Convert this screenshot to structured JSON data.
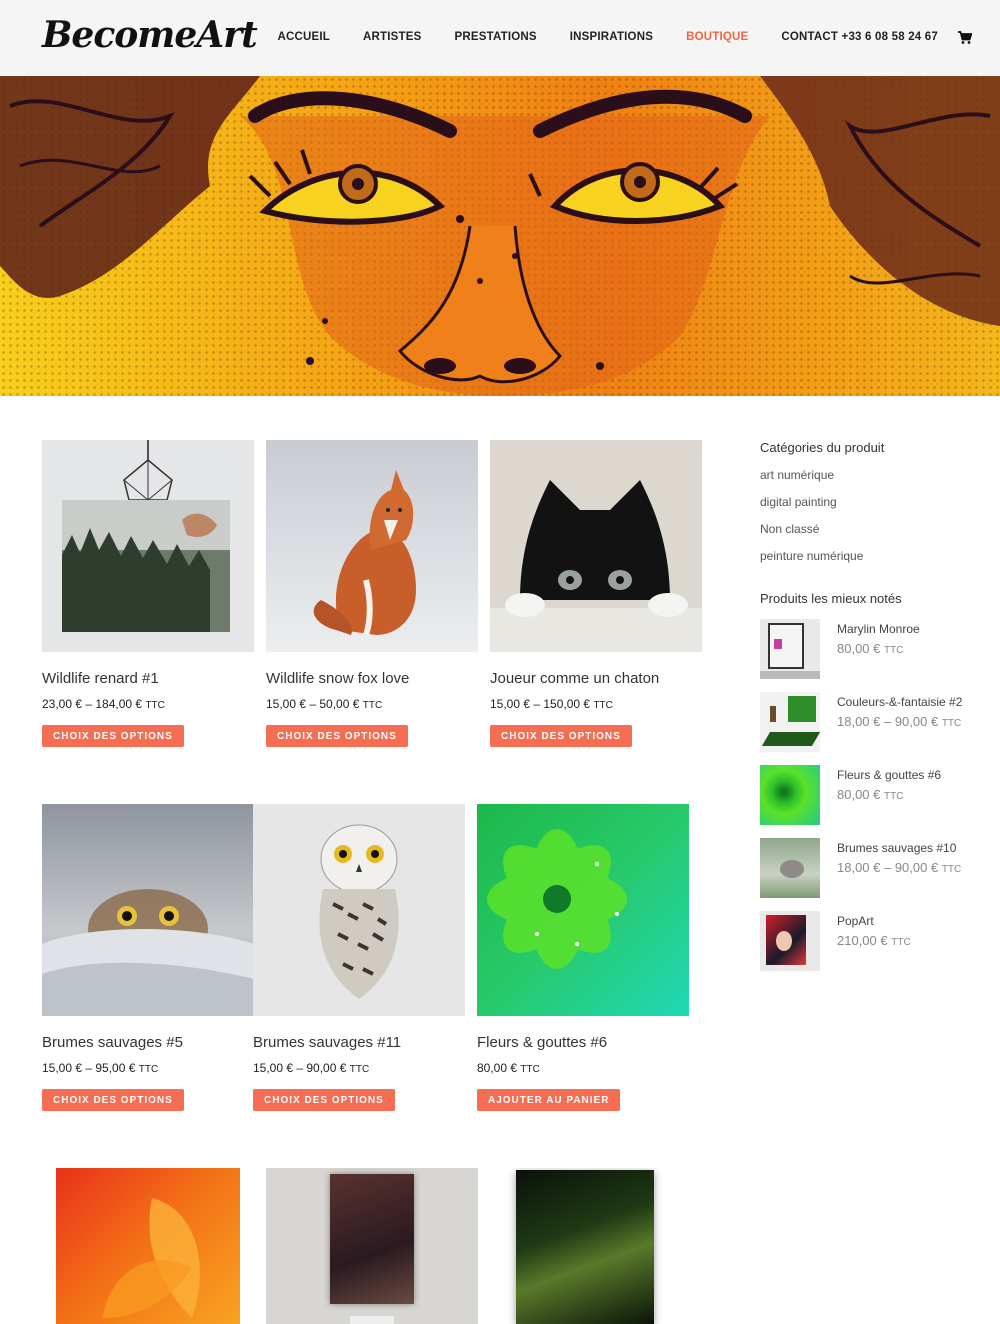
{
  "header": {
    "logo": "BecomeArt",
    "nav": [
      "ACCUEIL",
      "ARTISTES",
      "PRESTATIONS",
      "INSPIRATIONS",
      "BOUTIQUE",
      "CONTACT +33 6 08 58 24 67"
    ],
    "active_nav": "BOUTIQUE",
    "cart_icon": "shopping-cart-icon",
    "accent_color": "#f06543"
  },
  "hero": {
    "arrow": "›",
    "slide_count": 10,
    "active_slide": 1
  },
  "products": [
    {
      "title": "Wildlife renard #1",
      "price": "23,00 € – 184,00 €",
      "ttc": "TTC",
      "button": "CHOIX DES OPTIONS"
    },
    {
      "title": "Wildlife snow fox love",
      "price": "15,00 € – 50,00 €",
      "ttc": "TTC",
      "button": "CHOIX DES OPTIONS"
    },
    {
      "title": "Joueur comme un chaton",
      "price": "15,00 € – 150,00 €",
      "ttc": "TTC",
      "button": "CHOIX DES OPTIONS"
    },
    {
      "title": "Brumes sauvages #5",
      "price": "15,00 € – 95,00 €",
      "ttc": "TTC",
      "button": "CHOIX DES OPTIONS"
    },
    {
      "title": "Brumes sauvages #11",
      "price": "15,00 € – 90,00 €",
      "ttc": "TTC",
      "button": "CHOIX DES OPTIONS"
    },
    {
      "title": "Fleurs & gouttes #6",
      "price": "80,00 €",
      "ttc": "TTC",
      "button": "AJOUTER AU PANIER"
    }
  ],
  "sidebar": {
    "categories_title": "Catégories du produit",
    "categories": [
      "art numérique",
      "digital painting",
      "Non classé",
      "peinture numérique"
    ],
    "top_rated_title": "Produits les mieux notés",
    "top_rated": [
      {
        "name": "Marylin Monroe",
        "price": "80,00 €",
        "ttc": "TTC"
      },
      {
        "name": "Couleurs-&-fantaisie #2",
        "price": "18,00 € – 90,00 €",
        "ttc": "TTC"
      },
      {
        "name": "Fleurs & gouttes #6",
        "price": "80,00 €",
        "ttc": "TTC"
      },
      {
        "name": "Brumes sauvages #10",
        "price": "18,00 € – 90,00 €",
        "ttc": "TTC"
      },
      {
        "name": "PopArt",
        "price": "210,00 €",
        "ttc": "TTC"
      }
    ]
  },
  "button_color": "#f56d52"
}
